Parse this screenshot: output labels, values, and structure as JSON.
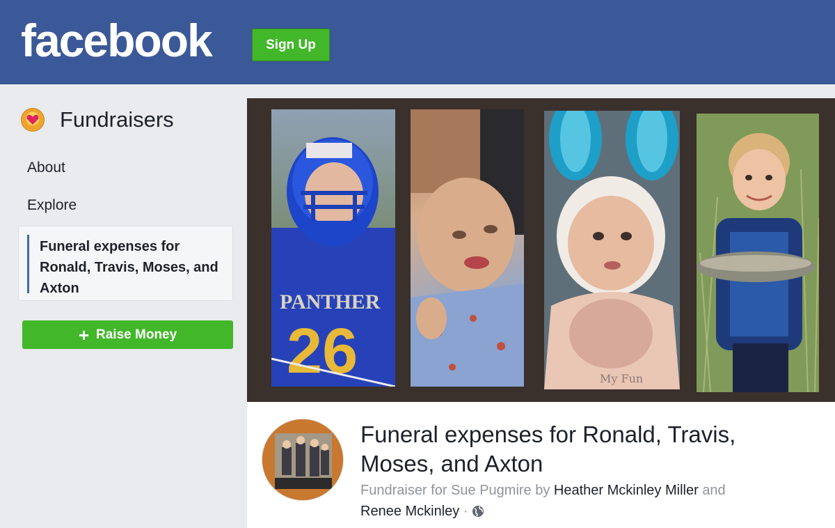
{
  "header": {
    "logo_text": "facebook",
    "signup_label": "Sign Up",
    "brand_color": "#3b5998",
    "button_color": "#42b72a"
  },
  "sidebar": {
    "title": "Fundraisers",
    "title_icon": "fundraiser-heart-icon",
    "items": [
      {
        "label": "About"
      },
      {
        "label": "Explore"
      },
      {
        "label": "Funeral expenses for Ronald, Travis, Moses, and Axton",
        "active": true
      }
    ],
    "raise_button": {
      "icon": "plus-icon",
      "label": "Raise Money"
    }
  },
  "fundraiser": {
    "cover_photos": [
      {
        "name": "cover-photo-football-player",
        "overlay_text": "PANTHER"
      },
      {
        "name": "cover-photo-toddler"
      },
      {
        "name": "cover-photo-baby-bunny-ears"
      },
      {
        "name": "cover-photo-boy-with-fish"
      }
    ],
    "title": "Funeral expenses for Ronald, Travis, Moses, and Axton",
    "subtitle_prefix": "Fundraiser for Sue Pugmire by",
    "organizer_1": "Heather Mckinley Miller",
    "conjunction": "and",
    "organizer_2": "Renee Mckinley",
    "separator": "·",
    "privacy_icon": "globe-icon"
  }
}
